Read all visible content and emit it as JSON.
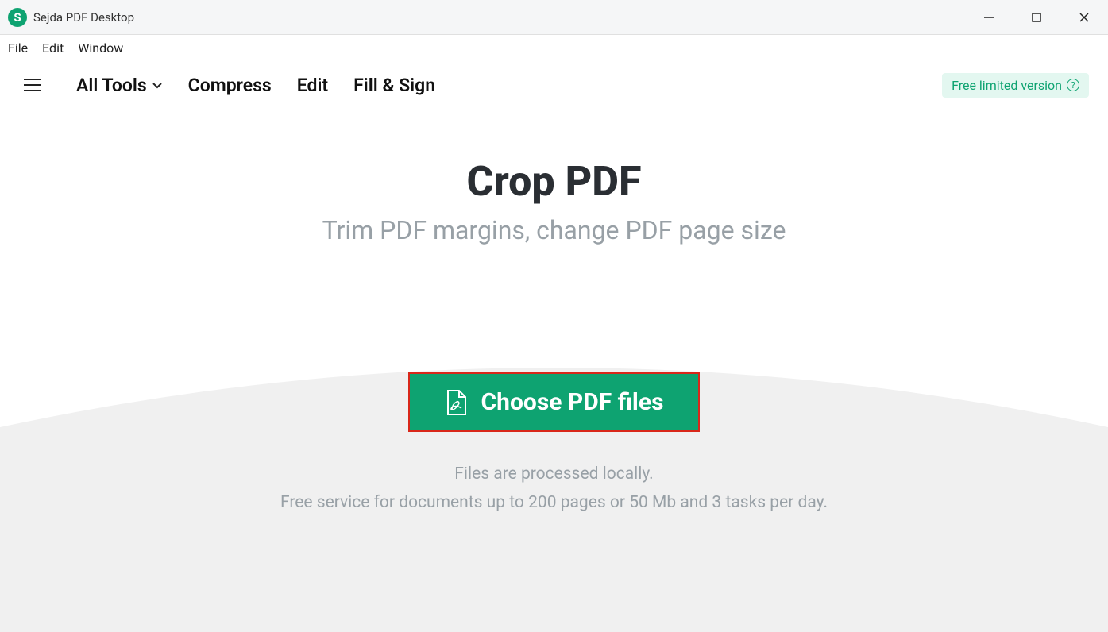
{
  "window": {
    "title": "Sejda PDF Desktop",
    "app_icon_letter": "S"
  },
  "menubar": {
    "file": "File",
    "edit": "Edit",
    "window": "Window"
  },
  "toolbar": {
    "all_tools": "All Tools",
    "compress": "Compress",
    "edit": "Edit",
    "fill_sign": "Fill & Sign",
    "version_badge": "Free limited version"
  },
  "main": {
    "title": "Crop PDF",
    "subtitle": "Trim PDF margins, change PDF page size",
    "choose_button": "Choose PDF files",
    "info_line1": "Files are processed locally.",
    "info_line2": "Free service for documents up to 200 pages or 50 Mb and 3 tasks per day."
  }
}
